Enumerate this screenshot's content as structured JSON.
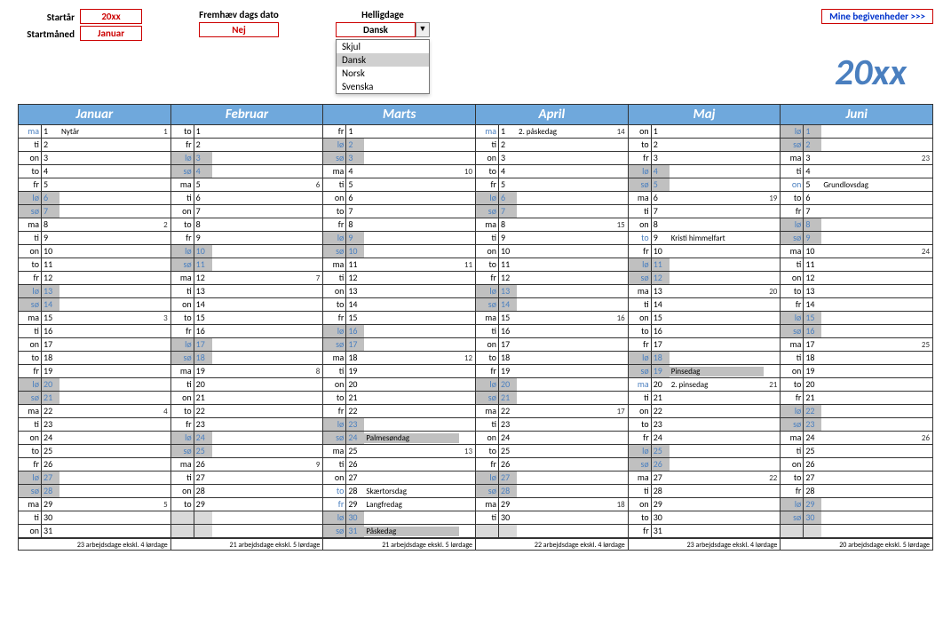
{
  "labels": {
    "startar": "Startår",
    "startmaned": "Startmåned",
    "fremhaev": "Fremhæv dags dato",
    "helligdage": "Helligdage",
    "mine": "Mine begivenheder >>>"
  },
  "values": {
    "startar": "20xx",
    "startmaned": "Januar",
    "fremhaev": "Nej",
    "helligdage": "Dansk"
  },
  "dropdown": [
    "Skjul",
    "Dansk",
    "Norsk",
    "Svenska"
  ],
  "dropdown_selected_index": 1,
  "year_big": "20xx",
  "months": [
    {
      "name": "Januar",
      "foot": "23 arbejdsdage ekskl. 4 lørdage",
      "days": [
        {
          "wd": "ma",
          "n": 1,
          "ev": "Nytår",
          "wk": 1,
          "h": true
        },
        {
          "wd": "ti",
          "n": 2
        },
        {
          "wd": "on",
          "n": 3
        },
        {
          "wd": "to",
          "n": 4
        },
        {
          "wd": "fr",
          "n": 5
        },
        {
          "wd": "lø",
          "n": 6,
          "we": true
        },
        {
          "wd": "sø",
          "n": 7,
          "we": true
        },
        {
          "wd": "ma",
          "n": 8,
          "wk": 2
        },
        {
          "wd": "ti",
          "n": 9
        },
        {
          "wd": "on",
          "n": 10
        },
        {
          "wd": "to",
          "n": 11
        },
        {
          "wd": "fr",
          "n": 12
        },
        {
          "wd": "lø",
          "n": 13,
          "we": true
        },
        {
          "wd": "sø",
          "n": 14,
          "we": true
        },
        {
          "wd": "ma",
          "n": 15,
          "wk": 3
        },
        {
          "wd": "ti",
          "n": 16
        },
        {
          "wd": "on",
          "n": 17
        },
        {
          "wd": "to",
          "n": 18
        },
        {
          "wd": "fr",
          "n": 19
        },
        {
          "wd": "lø",
          "n": 20,
          "we": true
        },
        {
          "wd": "sø",
          "n": 21,
          "we": true
        },
        {
          "wd": "ma",
          "n": 22,
          "wk": 4
        },
        {
          "wd": "ti",
          "n": 23
        },
        {
          "wd": "on",
          "n": 24
        },
        {
          "wd": "to",
          "n": 25
        },
        {
          "wd": "fr",
          "n": 26
        },
        {
          "wd": "lø",
          "n": 27,
          "we": true
        },
        {
          "wd": "sø",
          "n": 28,
          "we": true
        },
        {
          "wd": "ma",
          "n": 29,
          "wk": 5
        },
        {
          "wd": "ti",
          "n": 30
        },
        {
          "wd": "on",
          "n": 31
        }
      ]
    },
    {
      "name": "Februar",
      "foot": "21 arbejdsdage ekskl. 5 lørdage",
      "days": [
        {
          "wd": "to",
          "n": 1
        },
        {
          "wd": "fr",
          "n": 2
        },
        {
          "wd": "lø",
          "n": 3,
          "we": true
        },
        {
          "wd": "sø",
          "n": 4,
          "we": true
        },
        {
          "wd": "ma",
          "n": 5,
          "wk": 6
        },
        {
          "wd": "ti",
          "n": 6
        },
        {
          "wd": "on",
          "n": 7
        },
        {
          "wd": "to",
          "n": 8
        },
        {
          "wd": "fr",
          "n": 9
        },
        {
          "wd": "lø",
          "n": 10,
          "we": true
        },
        {
          "wd": "sø",
          "n": 11,
          "we": true
        },
        {
          "wd": "ma",
          "n": 12,
          "wk": 7
        },
        {
          "wd": "ti",
          "n": 13
        },
        {
          "wd": "on",
          "n": 14
        },
        {
          "wd": "to",
          "n": 15
        },
        {
          "wd": "fr",
          "n": 16
        },
        {
          "wd": "lø",
          "n": 17,
          "we": true
        },
        {
          "wd": "sø",
          "n": 18,
          "we": true
        },
        {
          "wd": "ma",
          "n": 19,
          "wk": 8
        },
        {
          "wd": "ti",
          "n": 20
        },
        {
          "wd": "on",
          "n": 21
        },
        {
          "wd": "to",
          "n": 22
        },
        {
          "wd": "fr",
          "n": 23
        },
        {
          "wd": "lø",
          "n": 24,
          "we": true
        },
        {
          "wd": "sø",
          "n": 25,
          "we": true
        },
        {
          "wd": "ma",
          "n": 26,
          "wk": 9
        },
        {
          "wd": "ti",
          "n": 27
        },
        {
          "wd": "on",
          "n": 28
        },
        {
          "wd": "to",
          "n": 29
        },
        {
          "empty": true
        },
        {
          "empty": true
        }
      ]
    },
    {
      "name": "Marts",
      "foot": "21 arbejdsdage ekskl. 5 lørdage",
      "days": [
        {
          "wd": "fr",
          "n": 1
        },
        {
          "wd": "lø",
          "n": 2,
          "we": true
        },
        {
          "wd": "sø",
          "n": 3,
          "we": true
        },
        {
          "wd": "ma",
          "n": 4,
          "wk": 10
        },
        {
          "wd": "ti",
          "n": 5
        },
        {
          "wd": "on",
          "n": 6
        },
        {
          "wd": "to",
          "n": 7
        },
        {
          "wd": "fr",
          "n": 8
        },
        {
          "wd": "lø",
          "n": 9,
          "we": true
        },
        {
          "wd": "sø",
          "n": 10,
          "we": true
        },
        {
          "wd": "ma",
          "n": 11,
          "wk": 11
        },
        {
          "wd": "ti",
          "n": 12
        },
        {
          "wd": "on",
          "n": 13
        },
        {
          "wd": "to",
          "n": 14
        },
        {
          "wd": "fr",
          "n": 15
        },
        {
          "wd": "lø",
          "n": 16,
          "we": true
        },
        {
          "wd": "sø",
          "n": 17,
          "we": true
        },
        {
          "wd": "ma",
          "n": 18,
          "wk": 12
        },
        {
          "wd": "ti",
          "n": 19
        },
        {
          "wd": "on",
          "n": 20
        },
        {
          "wd": "to",
          "n": 21
        },
        {
          "wd": "fr",
          "n": 22
        },
        {
          "wd": "lø",
          "n": 23,
          "we": true
        },
        {
          "wd": "sø",
          "n": 24,
          "we": true,
          "ev": "Palmesøndag"
        },
        {
          "wd": "ma",
          "n": 25,
          "wk": 13
        },
        {
          "wd": "ti",
          "n": 26
        },
        {
          "wd": "on",
          "n": 27
        },
        {
          "wd": "to",
          "n": 28,
          "ev": "Skærtorsdag",
          "h": true
        },
        {
          "wd": "fr",
          "n": 29,
          "ev": "Langfredag",
          "h": true
        },
        {
          "wd": "lø",
          "n": 30,
          "we": true
        },
        {
          "wd": "sø",
          "n": 31,
          "we": true,
          "ev": "Påskedag"
        }
      ]
    },
    {
      "name": "April",
      "foot": "22 arbejdsdage ekskl. 4 lørdage",
      "days": [
        {
          "wd": "ma",
          "n": 1,
          "ev": "2. påskedag",
          "wk": 14,
          "h": true
        },
        {
          "wd": "ti",
          "n": 2
        },
        {
          "wd": "on",
          "n": 3
        },
        {
          "wd": "to",
          "n": 4
        },
        {
          "wd": "fr",
          "n": 5
        },
        {
          "wd": "lø",
          "n": 6,
          "we": true
        },
        {
          "wd": "sø",
          "n": 7,
          "we": true
        },
        {
          "wd": "ma",
          "n": 8,
          "wk": 15
        },
        {
          "wd": "ti",
          "n": 9
        },
        {
          "wd": "on",
          "n": 10
        },
        {
          "wd": "to",
          "n": 11
        },
        {
          "wd": "fr",
          "n": 12
        },
        {
          "wd": "lø",
          "n": 13,
          "we": true
        },
        {
          "wd": "sø",
          "n": 14,
          "we": true
        },
        {
          "wd": "ma",
          "n": 15,
          "wk": 16
        },
        {
          "wd": "ti",
          "n": 16
        },
        {
          "wd": "on",
          "n": 17
        },
        {
          "wd": "to",
          "n": 18
        },
        {
          "wd": "fr",
          "n": 19
        },
        {
          "wd": "lø",
          "n": 20,
          "we": true
        },
        {
          "wd": "sø",
          "n": 21,
          "we": true
        },
        {
          "wd": "ma",
          "n": 22,
          "wk": 17
        },
        {
          "wd": "ti",
          "n": 23
        },
        {
          "wd": "on",
          "n": 24
        },
        {
          "wd": "to",
          "n": 25
        },
        {
          "wd": "fr",
          "n": 26
        },
        {
          "wd": "lø",
          "n": 27,
          "we": true
        },
        {
          "wd": "sø",
          "n": 28,
          "we": true
        },
        {
          "wd": "ma",
          "n": 29,
          "wk": 18
        },
        {
          "wd": "ti",
          "n": 30
        },
        {
          "empty": true
        }
      ]
    },
    {
      "name": "Maj",
      "foot": "23 arbejdsdage ekskl. 4 lørdage",
      "days": [
        {
          "wd": "on",
          "n": 1
        },
        {
          "wd": "to",
          "n": 2
        },
        {
          "wd": "fr",
          "n": 3
        },
        {
          "wd": "lø",
          "n": 4,
          "we": true
        },
        {
          "wd": "sø",
          "n": 5,
          "we": true
        },
        {
          "wd": "ma",
          "n": 6,
          "wk": 19
        },
        {
          "wd": "ti",
          "n": 7
        },
        {
          "wd": "on",
          "n": 8
        },
        {
          "wd": "to",
          "n": 9,
          "ev": "Kristi himmelfart",
          "h": true
        },
        {
          "wd": "fr",
          "n": 10
        },
        {
          "wd": "lø",
          "n": 11,
          "we": true
        },
        {
          "wd": "sø",
          "n": 12,
          "we": true
        },
        {
          "wd": "ma",
          "n": 13,
          "wk": 20
        },
        {
          "wd": "ti",
          "n": 14
        },
        {
          "wd": "on",
          "n": 15
        },
        {
          "wd": "to",
          "n": 16
        },
        {
          "wd": "fr",
          "n": 17
        },
        {
          "wd": "lø",
          "n": 18,
          "we": true
        },
        {
          "wd": "sø",
          "n": 19,
          "we": true,
          "ev": "Pinsedag"
        },
        {
          "wd": "ma",
          "n": 20,
          "ev": "2. pinsedag",
          "wk": 21,
          "h": true
        },
        {
          "wd": "ti",
          "n": 21
        },
        {
          "wd": "on",
          "n": 22
        },
        {
          "wd": "to",
          "n": 23
        },
        {
          "wd": "fr",
          "n": 24
        },
        {
          "wd": "lø",
          "n": 25,
          "we": true
        },
        {
          "wd": "sø",
          "n": 26,
          "we": true
        },
        {
          "wd": "ma",
          "n": 27,
          "wk": 22
        },
        {
          "wd": "ti",
          "n": 28
        },
        {
          "wd": "on",
          "n": 29
        },
        {
          "wd": "to",
          "n": 30
        },
        {
          "wd": "fr",
          "n": 31
        }
      ]
    },
    {
      "name": "Juni",
      "foot": "20 arbejdsdage ekskl. 5 lørdage",
      "days": [
        {
          "wd": "lø",
          "n": 1,
          "we": true
        },
        {
          "wd": "sø",
          "n": 2,
          "we": true
        },
        {
          "wd": "ma",
          "n": 3,
          "wk": 23
        },
        {
          "wd": "ti",
          "n": 4
        },
        {
          "wd": "on",
          "n": 5,
          "ev": "Grundlovsdag",
          "h": true
        },
        {
          "wd": "to",
          "n": 6
        },
        {
          "wd": "fr",
          "n": 7
        },
        {
          "wd": "lø",
          "n": 8,
          "we": true
        },
        {
          "wd": "sø",
          "n": 9,
          "we": true
        },
        {
          "wd": "ma",
          "n": 10,
          "wk": 24
        },
        {
          "wd": "ti",
          "n": 11
        },
        {
          "wd": "on",
          "n": 12
        },
        {
          "wd": "to",
          "n": 13
        },
        {
          "wd": "fr",
          "n": 14
        },
        {
          "wd": "lø",
          "n": 15,
          "we": true
        },
        {
          "wd": "sø",
          "n": 16,
          "we": true
        },
        {
          "wd": "ma",
          "n": 17,
          "wk": 25
        },
        {
          "wd": "ti",
          "n": 18
        },
        {
          "wd": "on",
          "n": 19
        },
        {
          "wd": "to",
          "n": 20
        },
        {
          "wd": "fr",
          "n": 21
        },
        {
          "wd": "lø",
          "n": 22,
          "we": true
        },
        {
          "wd": "sø",
          "n": 23,
          "we": true
        },
        {
          "wd": "ma",
          "n": 24,
          "wk": 26
        },
        {
          "wd": "ti",
          "n": 25
        },
        {
          "wd": "on",
          "n": 26
        },
        {
          "wd": "to",
          "n": 27
        },
        {
          "wd": "fr",
          "n": 28
        },
        {
          "wd": "lø",
          "n": 29,
          "we": true
        },
        {
          "wd": "sø",
          "n": 30,
          "we": true
        },
        {
          "empty": true
        }
      ]
    }
  ]
}
